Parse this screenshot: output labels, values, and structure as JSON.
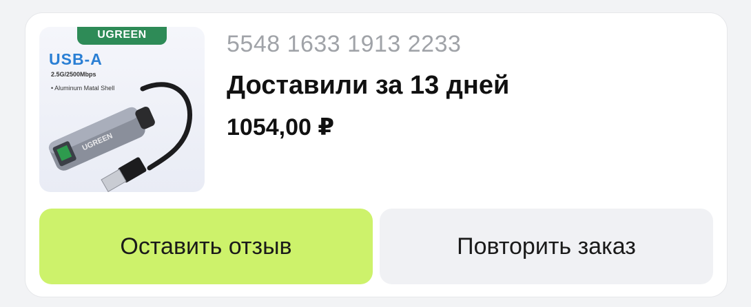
{
  "order": {
    "number": "5548 1633 1913 2233",
    "status": "Доставили за 13 дней",
    "price": "1054,00 ₽"
  },
  "product_image": {
    "brand": "UGREEN",
    "headline": "USB-A",
    "spec_speed": "2.5G/2500Mbps",
    "spec_shell": "• Aluminum Matal Shell",
    "device_label": "UGREEN",
    "icon": "usb-ethernet-adapter-icon"
  },
  "actions": {
    "review_label": "Оставить отзыв",
    "repeat_label": "Повторить заказ"
  },
  "colors": {
    "review_button": "#cdf26b",
    "repeat_button": "#f0f1f4",
    "brand_green": "#2e8b57",
    "usb_blue": "#2a7fd4"
  }
}
